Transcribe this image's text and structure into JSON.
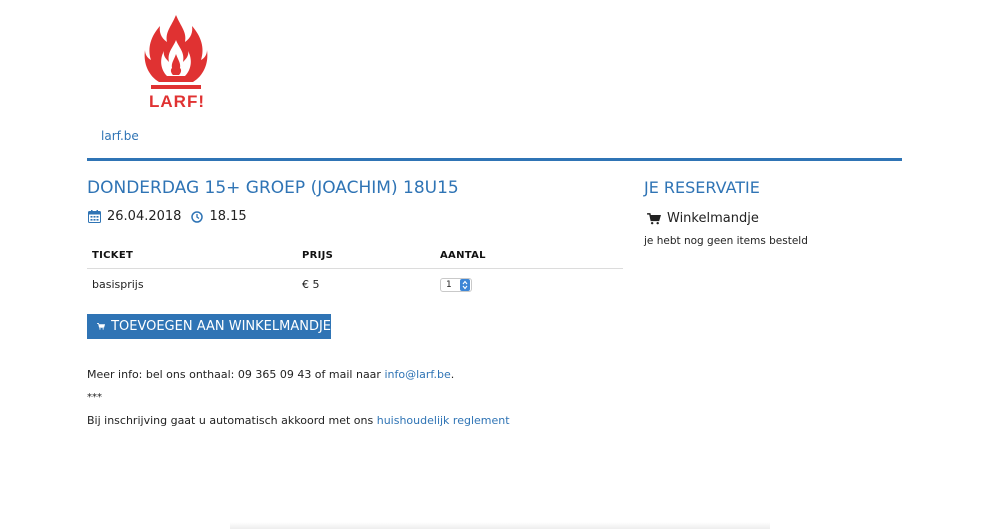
{
  "header": {
    "logo_text": "LARF!",
    "site_link": "larf.be",
    "brand_color": "#2f74b5",
    "logo_color": "#e03232"
  },
  "event": {
    "title": "DONDERDAG 15+ GROEP (JOACHIM) 18U15",
    "date": "26.04.2018",
    "time": "18.15",
    "date_icon": "calendar-icon",
    "time_icon": "clock-icon"
  },
  "tickets": {
    "columns": [
      "TICKET",
      "PRIJS",
      "AANTAL"
    ],
    "rows": [
      {
        "ticket": "basisprijs",
        "price": "€ 5",
        "quantity": "1"
      }
    ]
  },
  "add_button": {
    "label": "TOEVOEGEN AAN WINKELMANDJE",
    "icon": "cart-icon"
  },
  "info": {
    "text_before": "Meer info: bel ons onthaal: 09 365 09 43 of mail naar ",
    "email": "info@larf.be",
    "text_after": ".",
    "separator": "***",
    "terms_text": "Bij inschrijving gaat u automatisch akkoord met ons ",
    "terms_link": "huishoudelijk reglement"
  },
  "reservation": {
    "title": "JE RESERVATIE",
    "cart_label": "Winkelmandje",
    "empty_text": "je hebt nog geen items besteld"
  }
}
